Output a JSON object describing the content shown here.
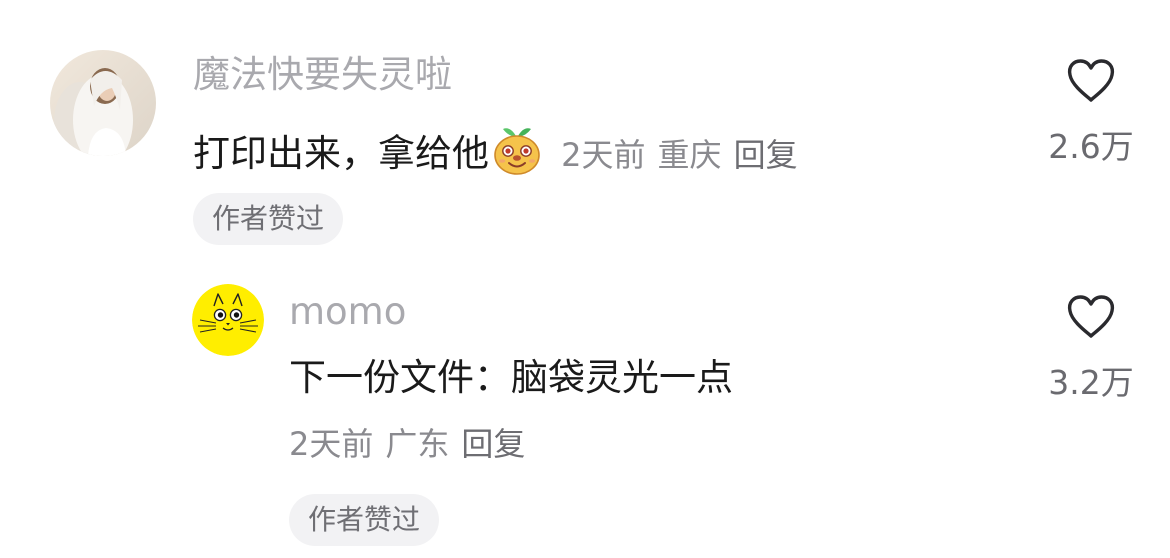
{
  "comment": {
    "username": "魔法快要失灵啦",
    "text": "打印出来，拿给他",
    "emoji_icon": "grinning-sprout-face-emoji-icon",
    "time": "2天前",
    "location": "重庆",
    "reply_label": "回复",
    "badge": "作者赞过",
    "like_count": "2.6万"
  },
  "reply": {
    "username": "momo",
    "text": "下一份文件：脑袋灵光一点",
    "time": "2天前",
    "location": "广东",
    "reply_label": "回复",
    "badge": "作者赞过",
    "like_count": "3.2万"
  },
  "colors": {
    "username": "#a9a9ae",
    "content_text": "#1a1a1a",
    "meta_text": "#8a8a8f",
    "badge_background": "#f2f2f4",
    "reply_avatar_background": "#ffee00"
  }
}
